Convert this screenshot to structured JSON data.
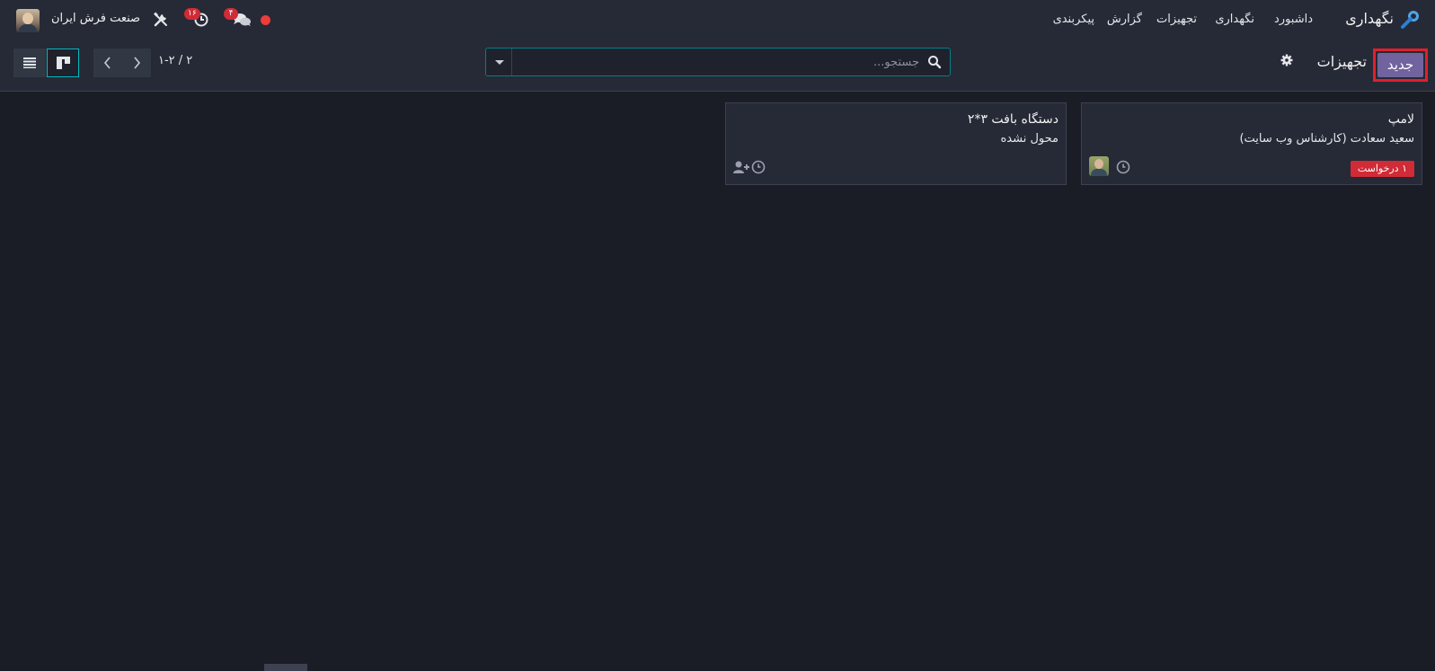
{
  "topbar": {
    "app_name": "نگهداری",
    "menu": [
      "داشبورد",
      "نگهداری",
      "تجهیزات",
      "گزارش",
      "پیکربندی"
    ],
    "company": "صنعت فرش ایران",
    "activity_badge": "۱۶",
    "messages_badge": "۴",
    "status_color": "#ee3b3b"
  },
  "control": {
    "new_label": "جدید",
    "title": "تجهیزات",
    "search_placeholder": "جستجو...",
    "pager": "۱-۲ / ۲"
  },
  "cards": [
    {
      "title": "لامپ",
      "subtitle": "سعید سعادت (کارشناس وب سایت)",
      "tag": "۱ درخواست"
    },
    {
      "title": "دستگاه بافت ۳*۲",
      "subtitle": "محول نشده"
    }
  ],
  "colors": {
    "accent": "#71639e",
    "highlight": "#e11f2d",
    "teal": "#017e84",
    "danger": "#d02b36"
  }
}
